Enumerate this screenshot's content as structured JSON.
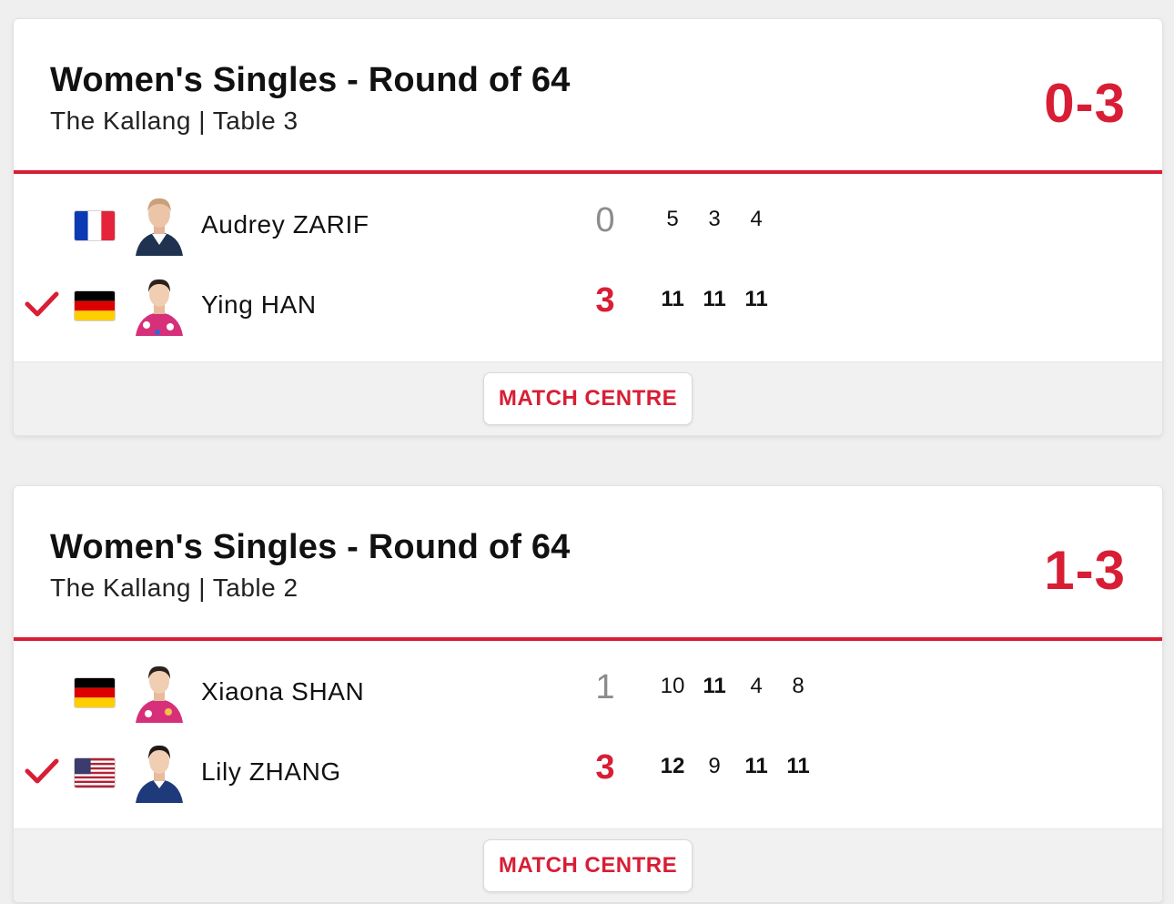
{
  "colors": {
    "accent": "#d81e35",
    "muted": "#8c8c8c",
    "text": "#111111"
  },
  "matches": [
    {
      "title": "Women's Singles - Round of 64",
      "venue": "The Kallang | Table 3",
      "score": "0-3",
      "button_label": "MATCH CENTRE",
      "players": [
        {
          "name": "Audrey ZARIF",
          "flag": "france-flag",
          "total": "0",
          "games": [
            "5",
            "3",
            "4"
          ],
          "winner": false
        },
        {
          "name": "Ying HAN",
          "flag": "germany-flag",
          "total": "3",
          "games": [
            "11",
            "11",
            "11"
          ],
          "winner": true
        }
      ]
    },
    {
      "title": "Women's Singles - Round of 64",
      "venue": "The Kallang | Table 2",
      "score": "1-3",
      "button_label": "MATCH CENTRE",
      "players": [
        {
          "name": "Xiaona SHAN",
          "flag": "germany-flag",
          "total": "1",
          "games": [
            "10",
            "11",
            "4",
            "8"
          ],
          "winner": false
        },
        {
          "name": "Lily ZHANG",
          "flag": "usa-flag",
          "total": "3",
          "games": [
            "12",
            "9",
            "11",
            "11"
          ],
          "winner": true
        }
      ]
    }
  ]
}
